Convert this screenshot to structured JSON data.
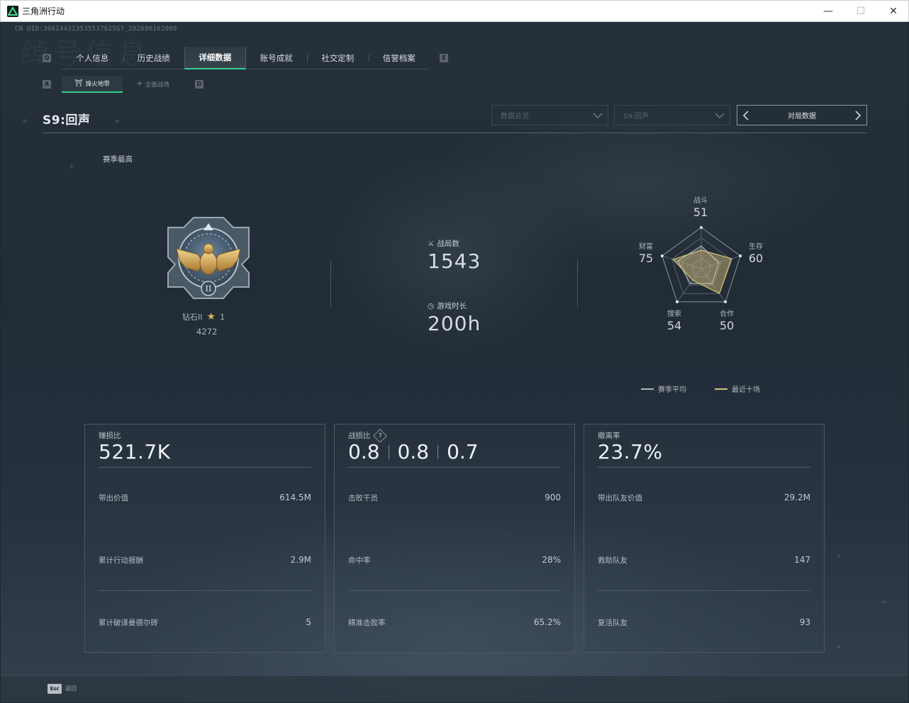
{
  "window": {
    "title": "三角洲行动",
    "minimize": "—",
    "maximize": "☐",
    "close": "✕"
  },
  "uid": "CN UID:366144313535537625G7_202606162008",
  "background_watermark": "绰号信息",
  "tabs": {
    "left_key": "Q",
    "right_key": "E",
    "items": [
      {
        "label": "个人信息"
      },
      {
        "label": "历史战绩"
      },
      {
        "label": "详细数据"
      },
      {
        "label": "账号成就"
      },
      {
        "label": "社交定制"
      },
      {
        "label": "信誉档案"
      }
    ],
    "active_index": 2
  },
  "subtabs": {
    "left_key": "A",
    "right_key": "D",
    "items": [
      {
        "label": "烽火地带",
        "icon": "landmark-icon"
      },
      {
        "label": "全面战场",
        "icon": "plane-icon"
      }
    ],
    "active_index": 0
  },
  "season_title": "S9:回声",
  "filters": {
    "dropdown1": "数据总览",
    "dropdown2": "S9:回声",
    "pager_label": "对局数据"
  },
  "rank": {
    "section_label": "赛季最高",
    "name": "钻石II",
    "stars": "1",
    "points": "4272",
    "medal_numeral": "II"
  },
  "stats": {
    "matches_label": "战局数",
    "matches_value": "1543",
    "playtime_label": "游戏时长",
    "playtime_value": "200h"
  },
  "radar": {
    "labels": [
      {
        "label": "战斗",
        "value": "51"
      },
      {
        "label": "生存",
        "value": "60"
      },
      {
        "label": "合作",
        "value": "50"
      },
      {
        "label": "搜索",
        "value": "54"
      },
      {
        "label": "财富",
        "value": "75"
      }
    ],
    "series": [
      {
        "name": "赛季平均",
        "color": "#aeb6bd",
        "values": [
          0.55,
          0.45,
          0.45,
          0.45,
          0.6
        ]
      },
      {
        "name": "最近十场",
        "color": "#d6c27a",
        "values": [
          0.45,
          0.78,
          0.75,
          0.35,
          0.72
        ]
      }
    ]
  },
  "cards": [
    {
      "head_label": "赚损比",
      "head_value": "521.7K",
      "rows": [
        {
          "label": "带出价值",
          "value": "614.5M"
        },
        {
          "label": "累计行动报酬",
          "value": "2.9M"
        },
        {
          "label": "累计破译曼德尔砖",
          "value": "5"
        }
      ]
    },
    {
      "head_label": "战损比",
      "head_values": [
        "0.8",
        "0.8",
        "0.7"
      ],
      "rows": [
        {
          "label": "击败干员",
          "value": "900"
        },
        {
          "label": "命中率",
          "value": "28%"
        },
        {
          "label": "精准击败率",
          "value": "65.2%"
        }
      ]
    },
    {
      "head_label": "撤离率",
      "head_value": "23.7%",
      "rows": [
        {
          "label": "带出队友价值",
          "value": "29.2M"
        },
        {
          "label": "救助队友",
          "value": "147"
        },
        {
          "label": "复活队友",
          "value": "93"
        }
      ]
    }
  ],
  "footer": {
    "esc_key": "Esc",
    "esc_label": "返回"
  },
  "colors": {
    "accent_green": "#2fd08e",
    "recent_series": "#d6c27a",
    "average_series": "#aeb6bd"
  }
}
